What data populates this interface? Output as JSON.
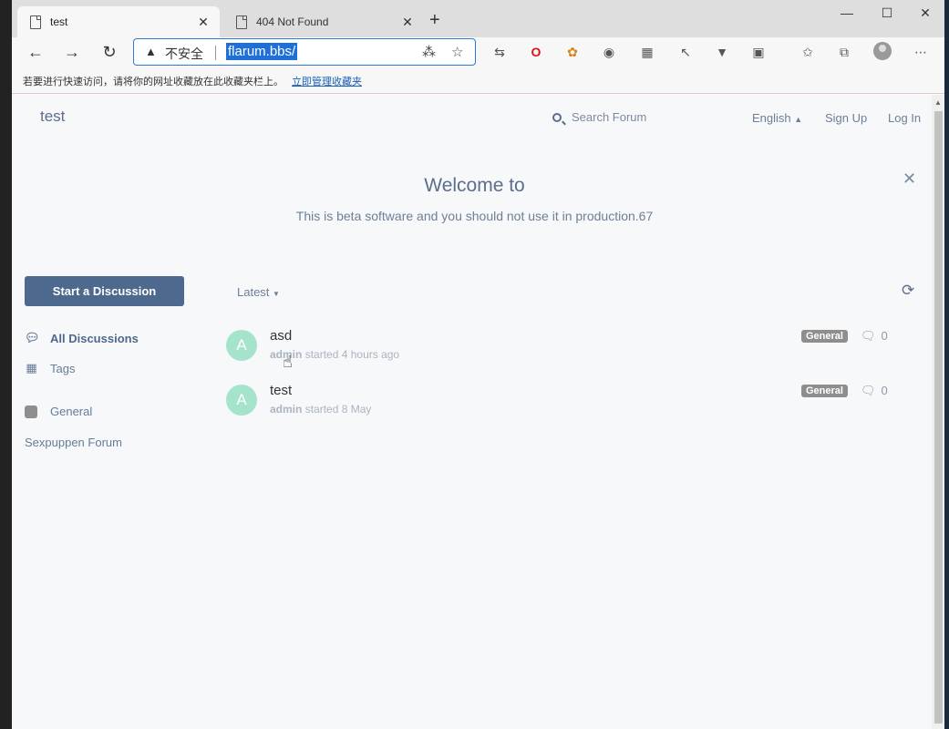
{
  "browser": {
    "tabs": [
      {
        "title": "test",
        "active": true
      },
      {
        "title": "404 Not Found",
        "active": false
      }
    ],
    "address": {
      "security_label": "不安全",
      "url": "flarum.bbs/"
    },
    "favorites_bar": {
      "hint": "若要进行快速访问，请将你的网址收藏放在此收藏夹栏上。",
      "manage_link": "立即管理收藏夹"
    }
  },
  "header": {
    "forum_title": "test",
    "search_placeholder": "Search Forum",
    "language": "English",
    "sign_up": "Sign Up",
    "log_in": "Log In"
  },
  "hero": {
    "title": "Welcome to",
    "subtitle": "This is beta software and you should not use it in production.67"
  },
  "sidebar": {
    "start_button": "Start a Discussion",
    "nav": [
      {
        "label": "All Discussions",
        "icon": "comments-icon"
      },
      {
        "label": "Tags",
        "icon": "tags-grid-icon"
      }
    ],
    "tags": [
      {
        "label": "General",
        "color": "#8e8e8e"
      }
    ],
    "extra_link": "Sexpuppen Forum"
  },
  "toolbar": {
    "sort_label": "Latest"
  },
  "discussions": [
    {
      "avatar_letter": "A",
      "title": "asd",
      "author": "admin",
      "started": "started 4 hours ago",
      "tag": "General",
      "replies": "0"
    },
    {
      "avatar_letter": "A",
      "title": "test",
      "author": "admin",
      "started": "started 8 May",
      "tag": "General",
      "replies": "0"
    }
  ],
  "colors": {
    "primary": "#4d698e",
    "avatar": "#a5e3cc",
    "tag_general": "#8e8e8e"
  }
}
